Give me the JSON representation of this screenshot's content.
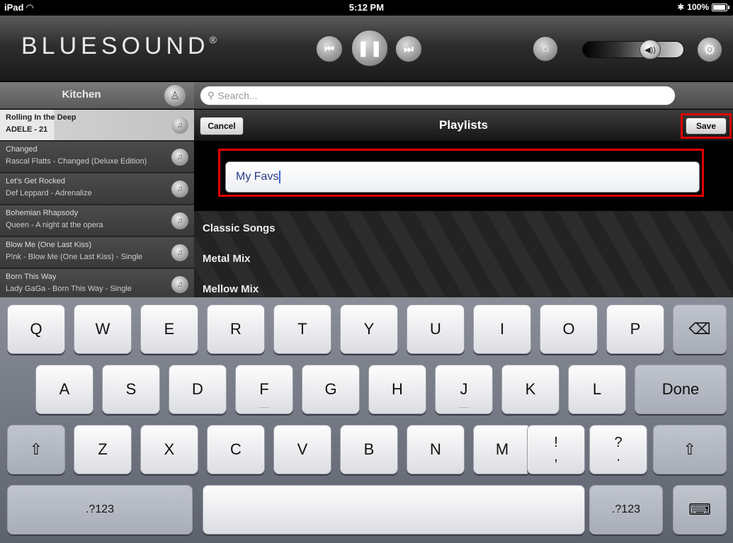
{
  "status_bar": {
    "device": "iPad",
    "wifi_icon": "wifi-icon",
    "time": "5:12 PM",
    "bluetooth_icon": "bluetooth-icon",
    "battery": "100%",
    "battery_level": 1.0
  },
  "header": {
    "logo": "BLUESOUND",
    "logo_mark": "®",
    "prev_icon": "⏮",
    "pause_icon": "❚❚",
    "next_icon": "⏭",
    "home_icon": "⌂",
    "volume_icon": "🔊",
    "volume_level": 0.62,
    "settings_icon": "⚙"
  },
  "zone": {
    "name": "Kitchen",
    "icon": "group-icon"
  },
  "search": {
    "placeholder": "Search...",
    "icon": "search-icon"
  },
  "queue": {
    "items": [
      {
        "title": "Rolling In the Deep",
        "subtitle": "ADELE - 21",
        "current": true
      },
      {
        "title": "Changed",
        "subtitle": "Rascal Flatts - Changed (Deluxe Edition)"
      },
      {
        "title": "Let's Get Rocked",
        "subtitle": "Def Leppard - Adrenalize"
      },
      {
        "title": "Bohemian Rhapsody",
        "subtitle": "Queen - A night at the opera"
      },
      {
        "title": "Blow Me (One Last Kiss)",
        "subtitle": "P!nk - Blow Me (One Last Kiss) - Single"
      },
      {
        "title": "Born This Way",
        "subtitle": "Lady GaGa - Born This Way - Single"
      }
    ]
  },
  "playlists": {
    "cancel_label": "Cancel",
    "title": "Playlists",
    "save_label": "Save",
    "name_value": "My Favs",
    "items": [
      "Classic Songs",
      "Metal Mix",
      "Mellow Mix"
    ]
  },
  "keyboard": {
    "row1": [
      "Q",
      "W",
      "E",
      "R",
      "T",
      "Y",
      "U",
      "I",
      "O",
      "P"
    ],
    "backspace": "⌫",
    "row2": [
      "A",
      "S",
      "D",
      "F",
      "G",
      "H",
      "J",
      "K",
      "L"
    ],
    "done_label": "Done",
    "shift": "⇧",
    "row3": [
      "Z",
      "X",
      "C",
      "V",
      "B",
      "N",
      "M"
    ],
    "punct1": [
      "!",
      ","
    ],
    "punct2": [
      "?",
      "."
    ],
    "numbers_label": ".?123",
    "hide_keyboard_icon": "⌨"
  },
  "colors": {
    "highlight": "#e00000",
    "input_text": "#2a3b86"
  }
}
